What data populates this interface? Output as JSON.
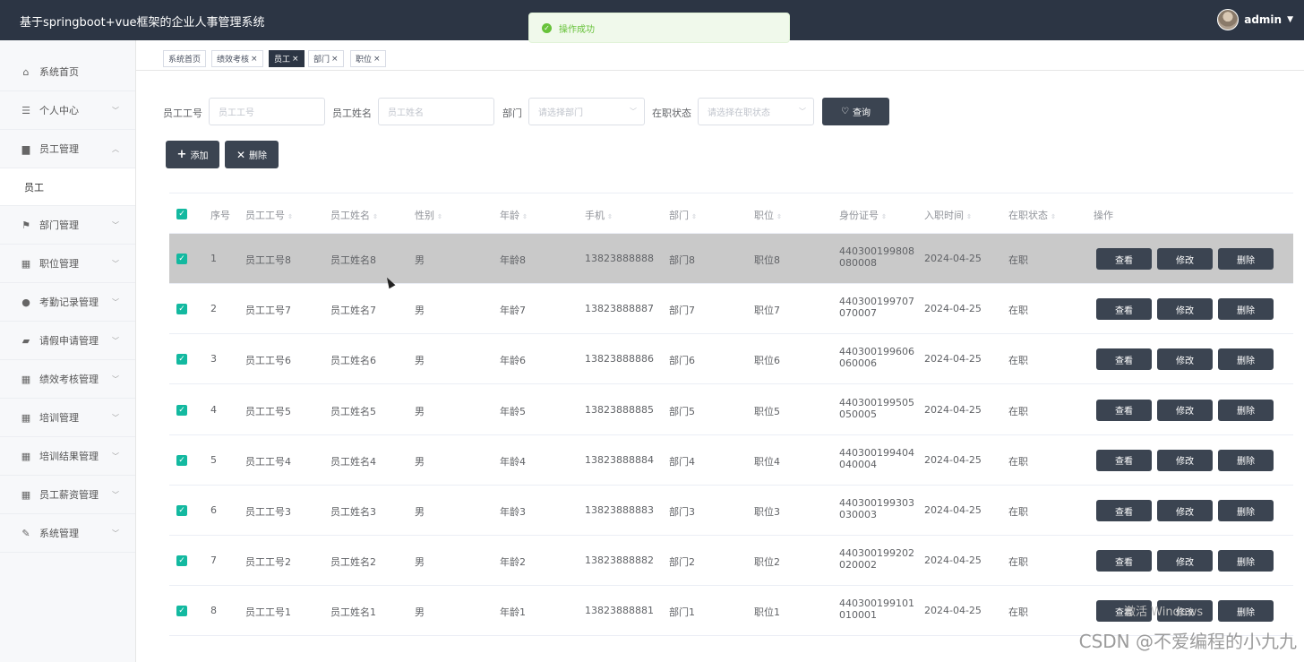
{
  "app": {
    "title": "基于springboot+vue框架的企业人事管理系统",
    "user": "admin"
  },
  "toast": {
    "message": "操作成功"
  },
  "sidebar": {
    "items": [
      {
        "label": "系统首页",
        "icon": "home-icon"
      },
      {
        "label": "个人中心",
        "icon": "list-icon"
      },
      {
        "label": "员工管理",
        "icon": "id-card-icon",
        "expanded": true,
        "sub": "员工"
      },
      {
        "label": "部门管理",
        "icon": "flag-icon"
      },
      {
        "label": "职位管理",
        "icon": "grid-icon"
      },
      {
        "label": "考勤记录管理",
        "icon": "user-icon"
      },
      {
        "label": "请假申请管理",
        "icon": "briefcase-icon"
      },
      {
        "label": "绩效考核管理",
        "icon": "grid-icon"
      },
      {
        "label": "培训管理",
        "icon": "grid-icon"
      },
      {
        "label": "培训结果管理",
        "icon": "grid-icon"
      },
      {
        "label": "员工薪资管理",
        "icon": "grid-icon"
      },
      {
        "label": "系统管理",
        "icon": "edit-icon"
      }
    ]
  },
  "tabs": [
    "系统首页",
    "绩效考核",
    "员工",
    "部门",
    "职位"
  ],
  "search": {
    "emp_no_label": "员工工号",
    "emp_no_placeholder": "员工工号",
    "emp_name_label": "员工姓名",
    "emp_name_placeholder": "员工姓名",
    "dept_label": "部门",
    "dept_placeholder": "请选择部门",
    "status_label": "在职状态",
    "status_placeholder": "请选择在职状态",
    "query_button": "查询"
  },
  "toolbar": {
    "add_button": "添加",
    "delete_button": "删除"
  },
  "table": {
    "headers": [
      "序号",
      "员工工号",
      "员工姓名",
      "性别",
      "年龄",
      "手机",
      "部门",
      "职位",
      "身份证号",
      "入职时间",
      "在职状态",
      "操作"
    ],
    "actions": [
      "查看",
      "修改",
      "删除"
    ],
    "rows": [
      {
        "no": "1",
        "emp_no": "员工工号8",
        "name": "员工姓名8",
        "gender": "男",
        "age": "年龄8",
        "phone": "13823888888",
        "dept": "部门8",
        "position": "职位8",
        "id_a": "440300199808",
        "id_b": "080008",
        "date": "2024-04-25",
        "status": "在职"
      },
      {
        "no": "2",
        "emp_no": "员工工号7",
        "name": "员工姓名7",
        "gender": "男",
        "age": "年龄7",
        "phone": "13823888887",
        "dept": "部门7",
        "position": "职位7",
        "id_a": "440300199707",
        "id_b": "070007",
        "date": "2024-04-25",
        "status": "在职"
      },
      {
        "no": "3",
        "emp_no": "员工工号6",
        "name": "员工姓名6",
        "gender": "男",
        "age": "年龄6",
        "phone": "13823888886",
        "dept": "部门6",
        "position": "职位6",
        "id_a": "440300199606",
        "id_b": "060006",
        "date": "2024-04-25",
        "status": "在职"
      },
      {
        "no": "4",
        "emp_no": "员工工号5",
        "name": "员工姓名5",
        "gender": "男",
        "age": "年龄5",
        "phone": "13823888885",
        "dept": "部门5",
        "position": "职位5",
        "id_a": "440300199505",
        "id_b": "050005",
        "date": "2024-04-25",
        "status": "在职"
      },
      {
        "no": "5",
        "emp_no": "员工工号4",
        "name": "员工姓名4",
        "gender": "男",
        "age": "年龄4",
        "phone": "13823888884",
        "dept": "部门4",
        "position": "职位4",
        "id_a": "440300199404",
        "id_b": "040004",
        "date": "2024-04-25",
        "status": "在职"
      },
      {
        "no": "6",
        "emp_no": "员工工号3",
        "name": "员工姓名3",
        "gender": "男",
        "age": "年龄3",
        "phone": "13823888883",
        "dept": "部门3",
        "position": "职位3",
        "id_a": "440300199303",
        "id_b": "030003",
        "date": "2024-04-25",
        "status": "在职"
      },
      {
        "no": "7",
        "emp_no": "员工工号2",
        "name": "员工姓名2",
        "gender": "男",
        "age": "年龄2",
        "phone": "13823888882",
        "dept": "部门2",
        "position": "职位2",
        "id_a": "440300199202",
        "id_b": "020002",
        "date": "2024-04-25",
        "status": "在职"
      },
      {
        "no": "8",
        "emp_no": "员工工号1",
        "name": "员工姓名1",
        "gender": "男",
        "age": "年龄1",
        "phone": "13823888881",
        "dept": "部门1",
        "position": "职位1",
        "id_a": "440300199101",
        "id_b": "010001",
        "date": "2024-04-25",
        "status": "在职"
      }
    ]
  },
  "watermark": {
    "csdn": "CSDN @不爱编程的小九九",
    "windows": "激活 Windows"
  },
  "colors": {
    "header": "#2c3544",
    "button": "#3b4451",
    "checkbox": "#13b9a0",
    "toast": "#67c23a"
  }
}
